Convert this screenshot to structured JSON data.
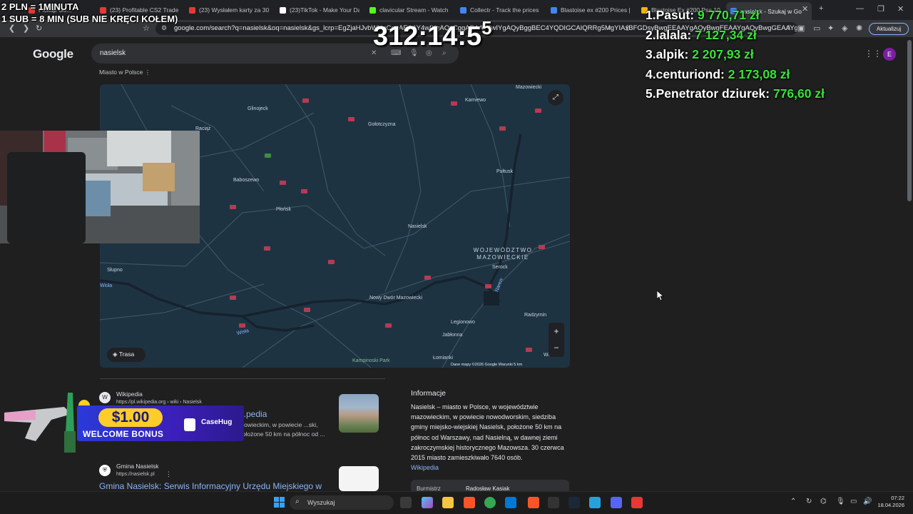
{
  "browser": {
    "tabs": [
      {
        "label": "Pickup Go...",
        "color": "#e53935"
      },
      {
        "label": "(23) Profitable CS2 Trade U",
        "color": "#e53935"
      },
      {
        "label": "(23) Wysłałem karty za 30",
        "color": "#e53935"
      },
      {
        "label": "(23)TikTok - Make Your Da",
        "color": "#ffffff"
      },
      {
        "label": "clavicular Stream - Watch",
        "color": "#53fc18"
      },
      {
        "label": "Collectr - Track the prices",
        "color": "#4285f4"
      },
      {
        "label": "Blastoise ex #200 Prices |",
        "color": "#4285f4"
      },
      {
        "label": "Blastoise Ex #200 Psa 10",
        "color": "#f4b400"
      },
      {
        "label": "nasielsk - Szukaj w Go",
        "color": "#4285f4"
      }
    ],
    "url": "google.com/search?q=nasielsk&oq=nasielsk&gs_lcrp=EgZjaHJvbWUqCggAEAAY4wIYgAQyCggAEAAY4wIYgAQyBggBEC4YQDIGCAIQRRg5MgYIAxBFGDsyBwgEEAAYgAQyBwgFEAAYgAQyBwgGEAAYgAQyBwgHEAAYgATSAQg...MTE3M2owajGoAgCwAgA&...",
    "update_label": "Aktualizuj"
  },
  "google": {
    "logo": "Google",
    "query": "nasielsk",
    "place_subtitle": "Miasto w Polsce",
    "avatar_letter": "E"
  },
  "map": {
    "cities": [
      {
        "name": "Glinojeck"
      },
      {
        "name": "Raciąż"
      },
      {
        "name": "Gołotczyzna"
      },
      {
        "name": "Karniewo"
      },
      {
        "name": "Mazowiecki"
      },
      {
        "name": "Baboszewo"
      },
      {
        "name": "Płońsk"
      },
      {
        "name": "Pułtusk"
      },
      {
        "name": "Nasielsk"
      },
      {
        "name": "Serock"
      },
      {
        "name": "Słupno"
      },
      {
        "name": "Wisła"
      },
      {
        "name": "Nowy Dwór Mazowiecki"
      },
      {
        "name": "Legionowo"
      },
      {
        "name": "Radzymin"
      },
      {
        "name": "Jabłonna"
      },
      {
        "name": "Łomianki"
      },
      {
        "name": "Kampinoski Park"
      },
      {
        "name": "Wisła"
      },
      {
        "name": "Narew"
      },
      {
        "name": "Wo..."
      }
    ],
    "region_label": "WOJEWÓDZTWO MAZOWIECKIE",
    "route_label": "Trasa",
    "attribution": "Dane mapy ©2026 Google   Warunki   5 km"
  },
  "results": [
    {
      "source": "Wikipedia",
      "url": "https://pl.wikipedia.org › wiki › Nasielsk",
      "title": "...pedia",
      "snippet": "...owieckim, w powiecie ...ski, położone 50 km na północ od ..."
    },
    {
      "source": "Gmina Nasielsk",
      "url": "https://nasielsk.pl",
      "title": "Gmina Nasielsk: Serwis Informacyjny Urzędu Miejskiego w"
    }
  ],
  "info": {
    "heading": "Informacje",
    "text": "Nasielsk – miasto w Polsce, w województwie mazowieckim, w powiecie nowodworskim, siedziba gminy miejsko-wiejskiej Nasielsk, położone 50 km na północ od Warszawy, nad Nasielną, w dawnej ziemi zakroczymskiej historycznego Mazowsza. 30 czerwca 2015 miasto zamieszkiwało 7640 osób.",
    "link": "Wikipedia",
    "mayor_label": "Burmistrz",
    "mayor_value": "Radosław Kasiak"
  },
  "overlay": {
    "timer": "312:14:5",
    "timer_extra": "5",
    "rule_1": "2 PLN = 1MINUTA",
    "rule_2": "1 SUB = 8 MIN (SUB NIE KRĘCI KOŁEM)",
    "leaderboard": [
      {
        "rank": "1.",
        "name": "Pasut:",
        "amount": "9 770,71 zł"
      },
      {
        "rank": "2.",
        "name": "lalala:",
        "amount": "7 127,34 zł"
      },
      {
        "rank": "3.",
        "name": "alpik:",
        "amount": "2 207,93 zł"
      },
      {
        "rank": "4.",
        "name": "centuriond:",
        "amount": "2 173,08 zł"
      },
      {
        "rank": "5.",
        "name": "Penetrator dziurek:",
        "amount": "776,60 zł"
      }
    ],
    "promo_amount": "$1.00",
    "promo_label": "WELCOME BONUS",
    "promo_brand": "CaseHug"
  },
  "taskbar": {
    "search_placeholder": "Wyszukaj",
    "time": "07:22",
    "date": "18.04.2026"
  }
}
